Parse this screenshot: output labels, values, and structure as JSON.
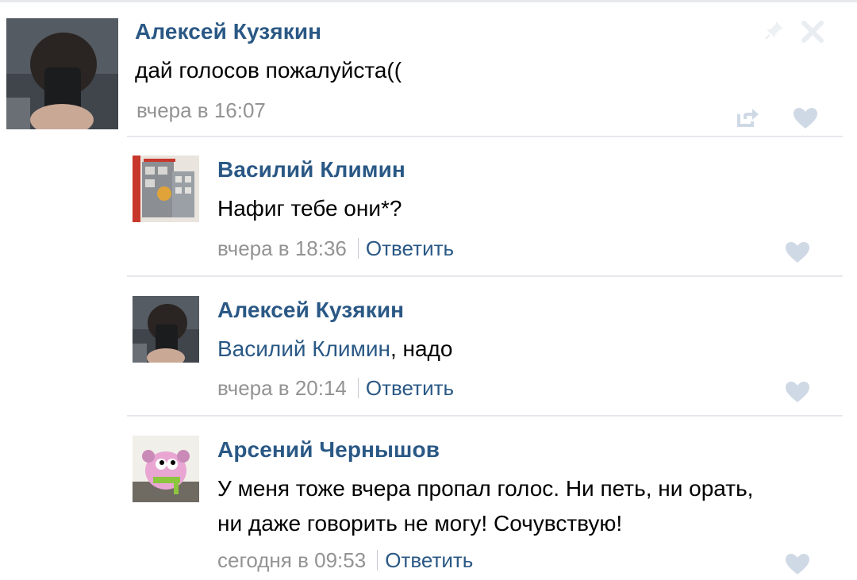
{
  "post": {
    "author": "Алексей Кузякин",
    "text": "дай голосов пожалуйста((",
    "time": "вчера в 16:07"
  },
  "comments": [
    {
      "author": "Василий Климин",
      "text": "Нафиг тебе они*?",
      "time": "вчера в 18:36",
      "reply_label": "Ответить"
    },
    {
      "author": "Алексей Кузякин",
      "mention": "Василий Климин",
      "text": ", надо",
      "time": "вчера в 20:14",
      "reply_label": "Ответить"
    },
    {
      "author": "Арсений Чернышов",
      "text_line1": "У меня тоже вчера пропал голос. Ни петь, ни орать,",
      "text_line2": "ни даже говорить не могу! Сочувствую!",
      "time": "сегодня в 09:53",
      "reply_label": "Ответить"
    }
  ],
  "colors": {
    "link": "#2a5885",
    "meta": "#939393",
    "divider": "#e7e8ec",
    "icon": "#cfd9e5"
  },
  "icons": [
    "pin-icon",
    "close-icon",
    "share-icon",
    "like-heart-icon"
  ]
}
